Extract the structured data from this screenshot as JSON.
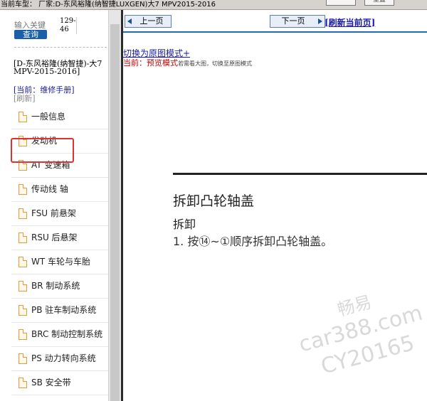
{
  "topbar": {
    "model_text": "当前车型： 厂家:D-东风裕隆(纳智捷LUXGEN)大7 MPV2015-2016",
    "btn_a": "",
    "btn_b": "重置"
  },
  "sidebar": {
    "search_placeholder": "输入关键",
    "search_button": "查询",
    "page_count_top": "129-",
    "page_count_bottom": "46",
    "vehicle_text": "[D-东风裕隆(纳智捷)-大7 MPV-2015-2016]",
    "manual_link": "[当前：维修手册]",
    "refresh_link": "[刷新]",
    "items": [
      {
        "label": "一般信息"
      },
      {
        "label": "发动机"
      },
      {
        "label": "AT 变速箱"
      },
      {
        "label": "传动线 轴"
      },
      {
        "label": "FSU 前悬架"
      },
      {
        "label": "RSU 后悬架"
      },
      {
        "label": "WT 车轮与车胎"
      },
      {
        "label": "BR 制动系统"
      },
      {
        "label": "PB 驻车制动系统"
      },
      {
        "label": "BRC 制动控制系统"
      },
      {
        "label": "PS 动力转向系统"
      },
      {
        "label": "SB 安全带"
      }
    ]
  },
  "content": {
    "prev_button": "上一页",
    "next_button": "下一页",
    "refresh_page": "[刷新当前页]",
    "mode_link": "切换为原图模式+",
    "current_label": "当前：",
    "current_mode": "预览模式",
    "current_tip": "若需看大图，切换至原图模式",
    "doc_title": "拆卸凸轮轴盖",
    "doc_heading": "拆卸",
    "doc_step": "1.  按⑭~①顺序拆卸凸轮轴盖。"
  },
  "watermark": {
    "line1": "畅易",
    "line2": "car388.com",
    "line3": "CY20165"
  },
  "colors": {
    "accent": "#1a5fa8",
    "link": "#1a1aa6",
    "highlight": "#e03030",
    "icon": "#e39b3c"
  }
}
